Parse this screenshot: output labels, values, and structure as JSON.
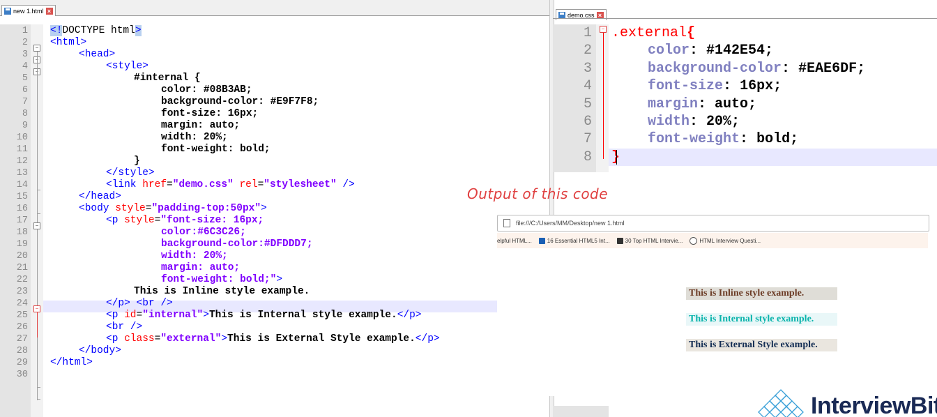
{
  "left_editor": {
    "tab_label": "new 1.html",
    "line_numbers": [
      "1",
      "2",
      "3",
      "4",
      "5",
      "6",
      "7",
      "8",
      "9",
      "10",
      "11",
      "12",
      "13",
      "14",
      "15",
      "16",
      "17",
      "18",
      "19",
      "20",
      "21",
      "22",
      "23",
      "24",
      "25",
      "26",
      "27",
      "28",
      "29",
      "30"
    ],
    "lines": {
      "l1a": "<!",
      "l1b": "DOCTYPE html",
      "l1c": ">",
      "l2": "<html>",
      "l3": "<head>",
      "l4": "<style>",
      "l5": "#internal {",
      "l6": "color: #08B3AB;",
      "l7": "background-color: #E9F7F8;",
      "l8": "font-size: 16px;",
      "l9": "margin: auto;",
      "l10": "width: 20%;",
      "l11": "font-weight: bold;",
      "l12": "}",
      "l13": "</style>",
      "l14a": "<link ",
      "l14b": "href",
      "l14c": "=",
      "l14d": "\"demo.css\"",
      "l14e": " rel",
      "l14f": "=",
      "l14g": "\"stylesheet\"",
      "l14h": " />",
      "l15": "</head>",
      "l16a": "<body ",
      "l16b": "style",
      "l16c": "=",
      "l16d": "\"padding-top:50px\"",
      "l16e": ">",
      "l17a": "<p ",
      "l17b": "style",
      "l17c": "=",
      "l17d": "\"font-size: 16px;",
      "l18": "color:#6C3C26;",
      "l19": "background-color:#DFDDD7;",
      "l20": "width: 20%;",
      "l21": "margin: auto;",
      "l22a": "font-weight: bold;\"",
      "l22b": ">",
      "l23": "This is Inline style example.",
      "l24a": "</p>",
      "l24b": " <br />",
      "l25a": "<p ",
      "l25b": "id",
      "l25c": "=",
      "l25d": "\"internal\"",
      "l25e": ">",
      "l25f": "This is Internal style example.",
      "l25g": "</p>",
      "l26": "<br />",
      "l27a": "<p ",
      "l27b": "class",
      "l27c": "=",
      "l27d": "\"external\"",
      "l27e": ">",
      "l27f": "This is External Style example.",
      "l27g": "</p>",
      "l28": "</body>",
      "l29": "</html>"
    }
  },
  "right_editor": {
    "tab_label": "demo.css",
    "line_numbers": [
      "1",
      "2",
      "3",
      "4",
      "5",
      "6",
      "7",
      "8"
    ],
    "selector": ".external",
    "open_brace": "{",
    "close_brace": "}",
    "rules": [
      {
        "prop": "color",
        "val": "#142E54;"
      },
      {
        "prop": "background-color",
        "val": "#EAE6DF;"
      },
      {
        "prop": "font-size",
        "val": "16px;"
      },
      {
        "prop": "margin",
        "val": "auto;"
      },
      {
        "prop": "width",
        "val": "20%;"
      },
      {
        "prop": "font-weight",
        "val": "bold;"
      }
    ],
    "colon": ":"
  },
  "annotation": "Output of this code",
  "browser": {
    "url": "file:///C:/Users/MM/Desktop/new 1.html",
    "bookmarks": [
      "elpful HTML...",
      "16 Essential HTML5 Int...",
      "30 Top HTML Intervie...",
      "HTML Interview Questi..."
    ],
    "bookmark_colors": [
      "#ffffff",
      "#1a5fb4",
      "#333333",
      "#555555"
    ],
    "paragraphs": {
      "inline": "This is Inline style example.",
      "internal": "This is Internal style example.",
      "external": "This is External Style example."
    }
  },
  "logo": {
    "text": "InterviewBit"
  },
  "colors": {
    "tag": "#0000ff",
    "attr": "#ff0000",
    "string": "#8000ff",
    "css_prop": "#8080c0",
    "annotation": "#e04040"
  }
}
